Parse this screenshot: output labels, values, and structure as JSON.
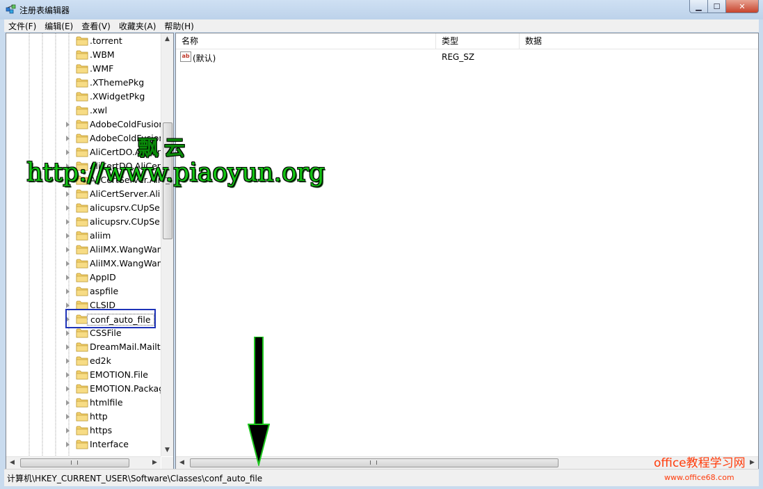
{
  "window": {
    "title": "注册表编辑器",
    "min_label": "▁",
    "max_label": "☐",
    "close_label": "✕"
  },
  "menu": [
    "文件(F)",
    "编辑(E)",
    "查看(V)",
    "收藏夹(A)",
    "帮助(H)"
  ],
  "tree": {
    "items": [
      {
        "label": ".torrent",
        "expand": false
      },
      {
        "label": ".WBM",
        "expand": false
      },
      {
        "label": ".WMF",
        "expand": false
      },
      {
        "label": ".XThemePkg",
        "expand": false
      },
      {
        "label": ".XWidgetPkg",
        "expand": false
      },
      {
        "label": ".xwl",
        "expand": false
      },
      {
        "label": "AdobeColdFusion",
        "expand": true
      },
      {
        "label": "AdobeColdFusion",
        "expand": true
      },
      {
        "label": "AliCertDO.AliCert",
        "expand": true
      },
      {
        "label": "AliCertDO.AliCertI",
        "expand": true
      },
      {
        "label": "AliCertServer.AliC",
        "expand": true
      },
      {
        "label": "AliCertServer.AliC",
        "expand": true
      },
      {
        "label": "alicupsrv.CUpServ",
        "expand": true
      },
      {
        "label": "alicupsrv.CUpServ",
        "expand": true
      },
      {
        "label": "aliim",
        "expand": true
      },
      {
        "label": "AliIMX.WangWan",
        "expand": true
      },
      {
        "label": "AliIMX.WangWan",
        "expand": true
      },
      {
        "label": "AppID",
        "expand": true
      },
      {
        "label": "aspfile",
        "expand": true
      },
      {
        "label": "CLSID",
        "expand": true
      },
      {
        "label": "conf_auto_file",
        "expand": true,
        "selected": true
      },
      {
        "label": "CSSFile",
        "expand": true
      },
      {
        "label": "DreamMail.Mailto",
        "expand": true
      },
      {
        "label": "ed2k",
        "expand": true
      },
      {
        "label": "EMOTION.File",
        "expand": true
      },
      {
        "label": "EMOTION.Packag",
        "expand": true
      },
      {
        "label": "htmlfile",
        "expand": true
      },
      {
        "label": "http",
        "expand": true
      },
      {
        "label": "https",
        "expand": true
      },
      {
        "label": "Interface",
        "expand": true
      }
    ],
    "scroll_up": "▲",
    "scroll_down": "▼",
    "scroll_left": "◀",
    "scroll_right": "▶",
    "grip": "≡",
    "hgrip": "III"
  },
  "list": {
    "columns": [
      "名称",
      "类型",
      "数据"
    ],
    "rows": [
      {
        "icon": "ab",
        "name": "(默认)",
        "type": "REG_SZ",
        "data": ""
      }
    ],
    "scroll_left": "◀",
    "scroll_right": "▶",
    "hgrip": "III"
  },
  "status": {
    "path": "计算机\\HKEY_CURRENT_USER\\Software\\Classes\\conf_auto_file"
  },
  "watermark": {
    "cn": "飘云",
    "url": "http://www.piaoyun.org",
    "site_logo": "office教程学习网",
    "site_url": "www.office68.com"
  },
  "colors": {
    "selection_box": "#1e33b8",
    "watermark_green": "#13c213",
    "site_orange": "#ff3b0a"
  }
}
